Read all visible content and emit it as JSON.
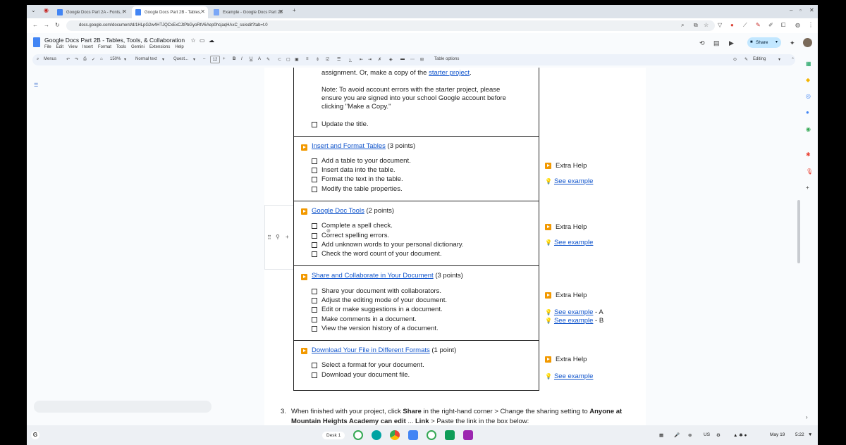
{
  "browser": {
    "tabs": [
      {
        "label": "Google Docs Part 2A - Fonts, I",
        "active": false
      },
      {
        "label": "Google Docs Part 2B - Tables,",
        "active": true
      },
      {
        "label": "Example - Google Docs Part 2B",
        "active": false
      }
    ],
    "url": "docs.google.com/document/d/1HLpG2w4HTJQCxExCJtPbGyoRtV6Aep0hcjaqHAxC_so/edit?tab=t.0"
  },
  "docs": {
    "title": "Google Docs Part 2B - Tables, Tools, & Collaboration",
    "menu": [
      "File",
      "Edit",
      "View",
      "Insert",
      "Format",
      "Tools",
      "Gemini",
      "Extensions",
      "Help"
    ],
    "share_label": "Share",
    "mode_label": "Editing"
  },
  "toolbar": {
    "menus_label": "Menus",
    "zoom": "150%",
    "style": "Normal text",
    "font": "Quest...",
    "font_size": "12",
    "table_options": "Table options"
  },
  "doc": {
    "top": {
      "note_line1_text": "assignment. Or, make a copy of the ",
      "note_line1_link": "starter project",
      "note_line1_end": ".",
      "note_line2": "Note: To avoid account errors with the starter project, please",
      "note_line3": "ensure you are signed into your school Google account before",
      "note_line4": "clicking \"Make a Copy.\"",
      "item": "Update the title."
    },
    "sections": [
      {
        "title_link": "Insert and Format Tables",
        "title_rest": " (3 points)",
        "items": [
          "Add a table to your document.",
          "Insert data into the table.",
          "Format the text in the table.",
          "Modify the table properties."
        ],
        "help": "Extra Help",
        "examples": [
          {
            "link": "See example",
            "suffix": ""
          }
        ]
      },
      {
        "title_link": "Google Doc Tools",
        "title_rest": " (2 points)",
        "items": [
          "Complete a spell check.",
          "Correct spelling errors.",
          "Add unknown words to your personal dictionary.",
          "Check the word count of your document."
        ],
        "help": "Extra Help",
        "examples": [
          {
            "link": "See example",
            "suffix": ""
          }
        ]
      },
      {
        "title_link": "Share and Collaborate in Your Document",
        "title_rest": "  (3 points)",
        "items": [
          "Share your document with collaborators.",
          "Adjust the editing mode of your document.",
          "Edit or make suggestions in a document.",
          "Make comments in a document.",
          "View the version history of a document."
        ],
        "help": "Extra Help",
        "examples": [
          {
            "link": "See example",
            "suffix": " - A"
          },
          {
            "link": "See example",
            "suffix": " - B"
          }
        ]
      },
      {
        "title_link": "Download Your File in Different Formats",
        "title_rest": " (1 point)",
        "items": [
          "Select a format for your document.",
          "Download your document file."
        ],
        "help": "Extra Help",
        "examples": [
          {
            "link": "See example",
            "suffix": ""
          }
        ]
      }
    ],
    "step3": {
      "number": "3.",
      "p1": "When finished with your project, click ",
      "b1": "Share",
      "p2": " in the right-hand corner > Change the sharing setting to ",
      "b2": "Anyone at Mountain Heights Academy can edit",
      "p3": " ... ",
      "b3": "Link",
      "p4": " > Paste the link in the box below:"
    }
  },
  "taskbar": {
    "desk_label": "Desk 1",
    "locale": "US",
    "date": "May 19",
    "time": "5:22"
  },
  "colors": {
    "link": "#1155cc",
    "section_icon": "#f29900",
    "share_button": "#c2e7ff"
  }
}
